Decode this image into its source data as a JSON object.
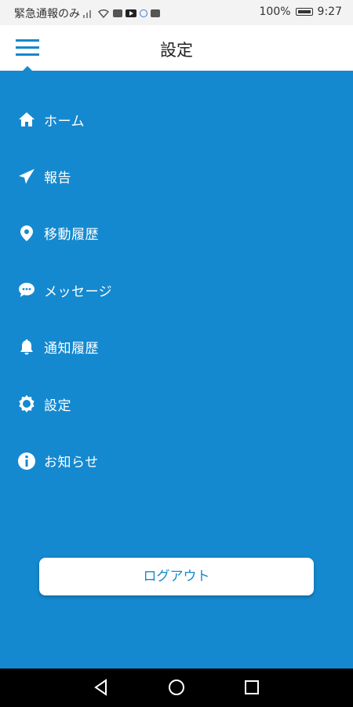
{
  "status_bar": {
    "left_text": "緊急通報のみ",
    "battery": "100%",
    "time": "9:27"
  },
  "header": {
    "title": "設定"
  },
  "menu": {
    "items": [
      {
        "label": "ホーム",
        "icon": "home-icon"
      },
      {
        "label": "報告",
        "icon": "paper-plane-icon"
      },
      {
        "label": "移動履歴",
        "icon": "location-pin-icon"
      },
      {
        "label": "メッセージ",
        "icon": "chat-bubble-icon"
      },
      {
        "label": "通知履歴",
        "icon": "bell-icon"
      },
      {
        "label": "設定",
        "icon": "gear-icon"
      },
      {
        "label": "お知らせ",
        "icon": "info-icon"
      }
    ]
  },
  "logout": {
    "label": "ログアウト"
  },
  "colors": {
    "accent": "#1589cf",
    "header_bg": "#ffffff",
    "nav_bg": "#000000"
  }
}
